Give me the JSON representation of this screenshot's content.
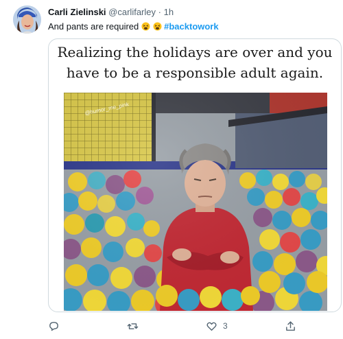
{
  "user": {
    "display_name": "Carli Zielinski",
    "handle": "@carlifarley",
    "separator": "·",
    "time": "1h"
  },
  "tweet": {
    "text": "And pants are required ",
    "hashtag": "#backtowork"
  },
  "media": {
    "caption_line1": "Realizing the holidays are over and you",
    "caption_line2": "have to be a responsible adult again.",
    "watermark": "@humor_me_pink"
  },
  "actions": {
    "reply_count": "",
    "retweet_count": "",
    "like_count": "3"
  },
  "colors": {
    "hashtag": "#1d9bf0",
    "muted": "#536471"
  },
  "icons": [
    "avatar",
    "tired-face-emoji",
    "reply-icon",
    "retweet-icon",
    "like-icon",
    "share-icon"
  ]
}
